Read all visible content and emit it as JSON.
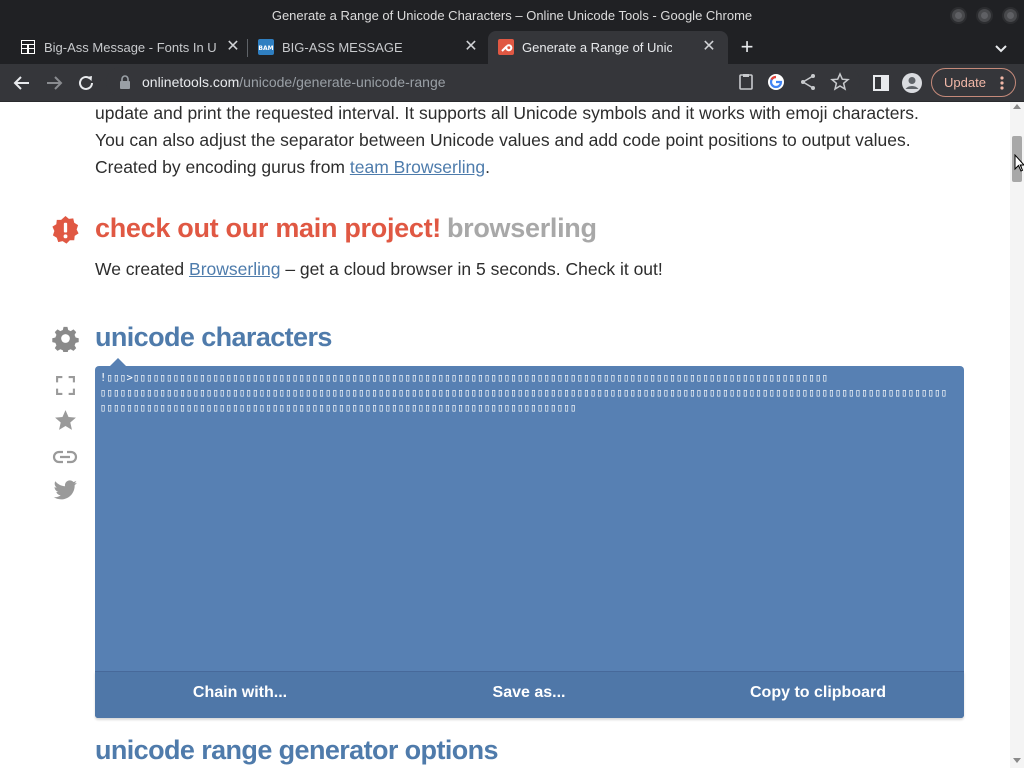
{
  "window": {
    "title": "Generate a Range of Unicode Characters – Online Unicode Tools - Google Chrome"
  },
  "tabs": [
    {
      "title": "Big-Ass Message - Fonts In Use",
      "favicon": "grid-favicon-icon"
    },
    {
      "title": "BIG-ASS MESSAGE",
      "favicon": "bam-favicon-icon",
      "favicon_text": "BAM"
    },
    {
      "title": "Generate a Range of Unicode Characters",
      "favicon": "wrench-favicon-icon",
      "active": true
    }
  ],
  "toolbar": {
    "url_host": "onlinetools.com",
    "url_path": "/unicode/generate-unicode-range",
    "update_label": "Update"
  },
  "page": {
    "intro": {
      "line1": "update and print the requested interval. It supports all Unicode symbols and it works with emoji characters.",
      "line2": "You can also adjust the separator between Unicode values and add code point positions to output values.",
      "line3_prefix": "Created by encoding gurus from ",
      "line3_link": "team Browserling",
      "line3_suffix": "."
    },
    "promo": {
      "title": "check out our main project!",
      "brand": "browserling",
      "text_prefix": "We created ",
      "text_link": "Browserling",
      "text_suffix": " – get a cloud browser in 5 seconds. Check it out!"
    },
    "output": {
      "title": "unicode characters",
      "lead_text": "!▯▯▯>",
      "buttons": {
        "chain": "Chain with...",
        "save": "Save as...",
        "copy": "Copy to clipboard"
      }
    },
    "options_title": "unicode range generator options"
  },
  "colors": {
    "accent_blue": "#4f7bab",
    "output_bg": "#5780b3",
    "alert_red": "#e05843",
    "brand_grey": "#a8a8a8"
  }
}
